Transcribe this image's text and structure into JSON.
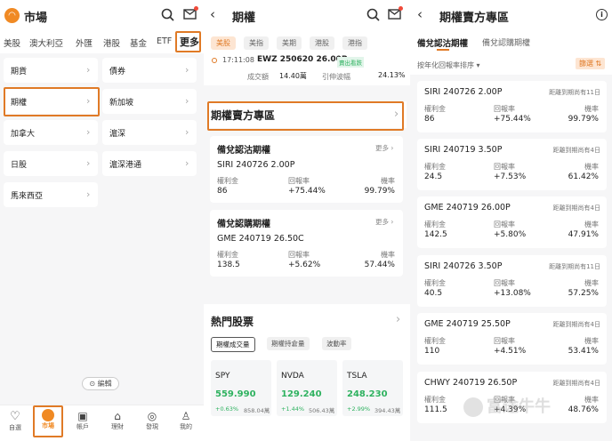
{
  "p1": {
    "title": "市場",
    "tabs": [
      "美股",
      "澳大利亞",
      "外匯",
      "港股",
      "基金",
      "ETF",
      "更多"
    ],
    "grid": [
      [
        "期貨",
        "債券"
      ],
      [
        "期權",
        "新加坡"
      ],
      [
        "加拿大",
        "滬深"
      ],
      [
        "日股",
        "滬深港通"
      ],
      [
        "馬來西亞",
        ""
      ]
    ],
    "edit": "編輯",
    "nav": [
      "自選",
      "市場",
      "帳戶",
      "理財",
      "發現",
      "我的"
    ]
  },
  "p2": {
    "title": "期權",
    "tabs": [
      "美股",
      "美指",
      "美期",
      "港股",
      "港指"
    ],
    "ticker": {
      "time": "17:11:08",
      "symbol": "EWZ 250620 26.00P",
      "tag": "賣出看跌",
      "l1": "成交額",
      "v1": "14.40萬",
      "l2": "引伸波幅",
      "v2": "24.13%"
    },
    "zone": "期權賣方專區",
    "cards": [
      {
        "title": "備兌認沽期權",
        "more": "更多",
        "sym": "SIRI 240726 2.00P",
        "l1": "權利金",
        "l2": "回報率",
        "l3": "機率",
        "v1": "86",
        "v2": "+75.44%",
        "v3": "99.79%"
      },
      {
        "title": "備兌認購期權",
        "more": "更多",
        "sym": "GME 240719 26.50C",
        "l1": "權利金",
        "l2": "回報率",
        "l3": "機率",
        "v1": "138.5",
        "v2": "+5.62%",
        "v3": "57.44%"
      }
    ],
    "hot": "熱門股票",
    "hot_tabs": [
      "期權成交量",
      "期權持倉量",
      "波動率"
    ],
    "stocks": [
      {
        "sym": "SPY",
        "price": "559.990",
        "chg": "+0.63%",
        "vol": "858.04萬"
      },
      {
        "sym": "NVDA",
        "price": "129.240",
        "chg": "+1.44%",
        "vol": "506.43萬"
      },
      {
        "sym": "TSLA",
        "price": "248.230",
        "chg": "+2.99%",
        "vol": "394.43萬"
      }
    ]
  },
  "p3": {
    "title": "期權賣方專區",
    "tabs": [
      "備兌認沽期權",
      "備兌認購期權"
    ],
    "sort": "按年化回報率排序",
    "filter": "篩選",
    "l1": "權利金",
    "l2": "回報率",
    "l3": "機率",
    "rows": [
      {
        "sym": "SIRI 240726 2.00P",
        "exp": "距離到期尚有11日",
        "v1": "86",
        "v2": "+75.44%",
        "v3": "99.79%"
      },
      {
        "sym": "SIRI 240719 3.50P",
        "exp": "距離到期尚有4日",
        "v1": "24.5",
        "v2": "+7.53%",
        "v3": "61.42%"
      },
      {
        "sym": "GME 240719 26.00P",
        "exp": "距離到期尚有4日",
        "v1": "142.5",
        "v2": "+5.80%",
        "v3": "47.91%"
      },
      {
        "sym": "SIRI 240726 3.50P",
        "exp": "距離到期尚有11日",
        "v1": "40.5",
        "v2": "+13.08%",
        "v3": "57.25%"
      },
      {
        "sym": "GME 240719 25.50P",
        "exp": "距離到期尚有4日",
        "v1": "110",
        "v2": "+4.51%",
        "v3": "53.41%"
      },
      {
        "sym": "CHWY 240719 26.50P",
        "exp": "距離到期尚有4日",
        "v1": "111.5",
        "v2": "+4.39%",
        "v3": "48.76%"
      }
    ],
    "watermark": "富途牛牛"
  },
  "colors": {
    "accent": "#e07a26",
    "green": "#2fb260",
    "orange": "#f08a24"
  }
}
